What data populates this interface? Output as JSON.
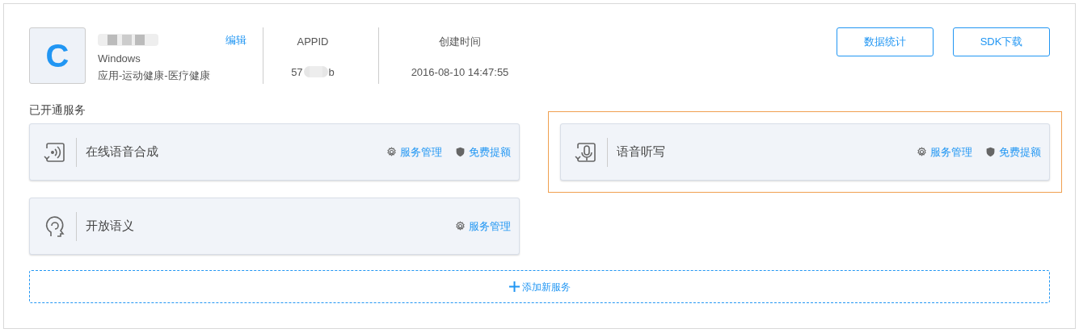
{
  "app": {
    "logo_letter": "C",
    "edit_link": "编辑",
    "platform": "Windows",
    "category": "应用-运动健康-医疗健康"
  },
  "info": [
    {
      "label": "APPID",
      "value_parts": [
        "57",
        "b"
      ]
    },
    {
      "label": "创建时间",
      "value_parts": [
        "2016-08-10 14:47:55"
      ]
    }
  ],
  "buttons": [
    "数据统计",
    "SDK下载"
  ],
  "services_title": "已开通服务",
  "services": [
    {
      "kind": "tts",
      "name": "在线语音合成",
      "highlighted": false,
      "actions": [
        {
          "kind": "manage",
          "label": "服务管理"
        },
        {
          "kind": "quota",
          "label": "免费提额"
        }
      ]
    },
    {
      "kind": "asr",
      "name": "语音听写",
      "highlighted": true,
      "actions": [
        {
          "kind": "manage",
          "label": "服务管理"
        },
        {
          "kind": "quota",
          "label": "免费提额"
        }
      ]
    },
    {
      "kind": "semantic",
      "name": "开放语义",
      "highlighted": false,
      "actions": [
        {
          "kind": "manage",
          "label": "服务管理"
        }
      ]
    }
  ],
  "add_service": "添加新服务"
}
